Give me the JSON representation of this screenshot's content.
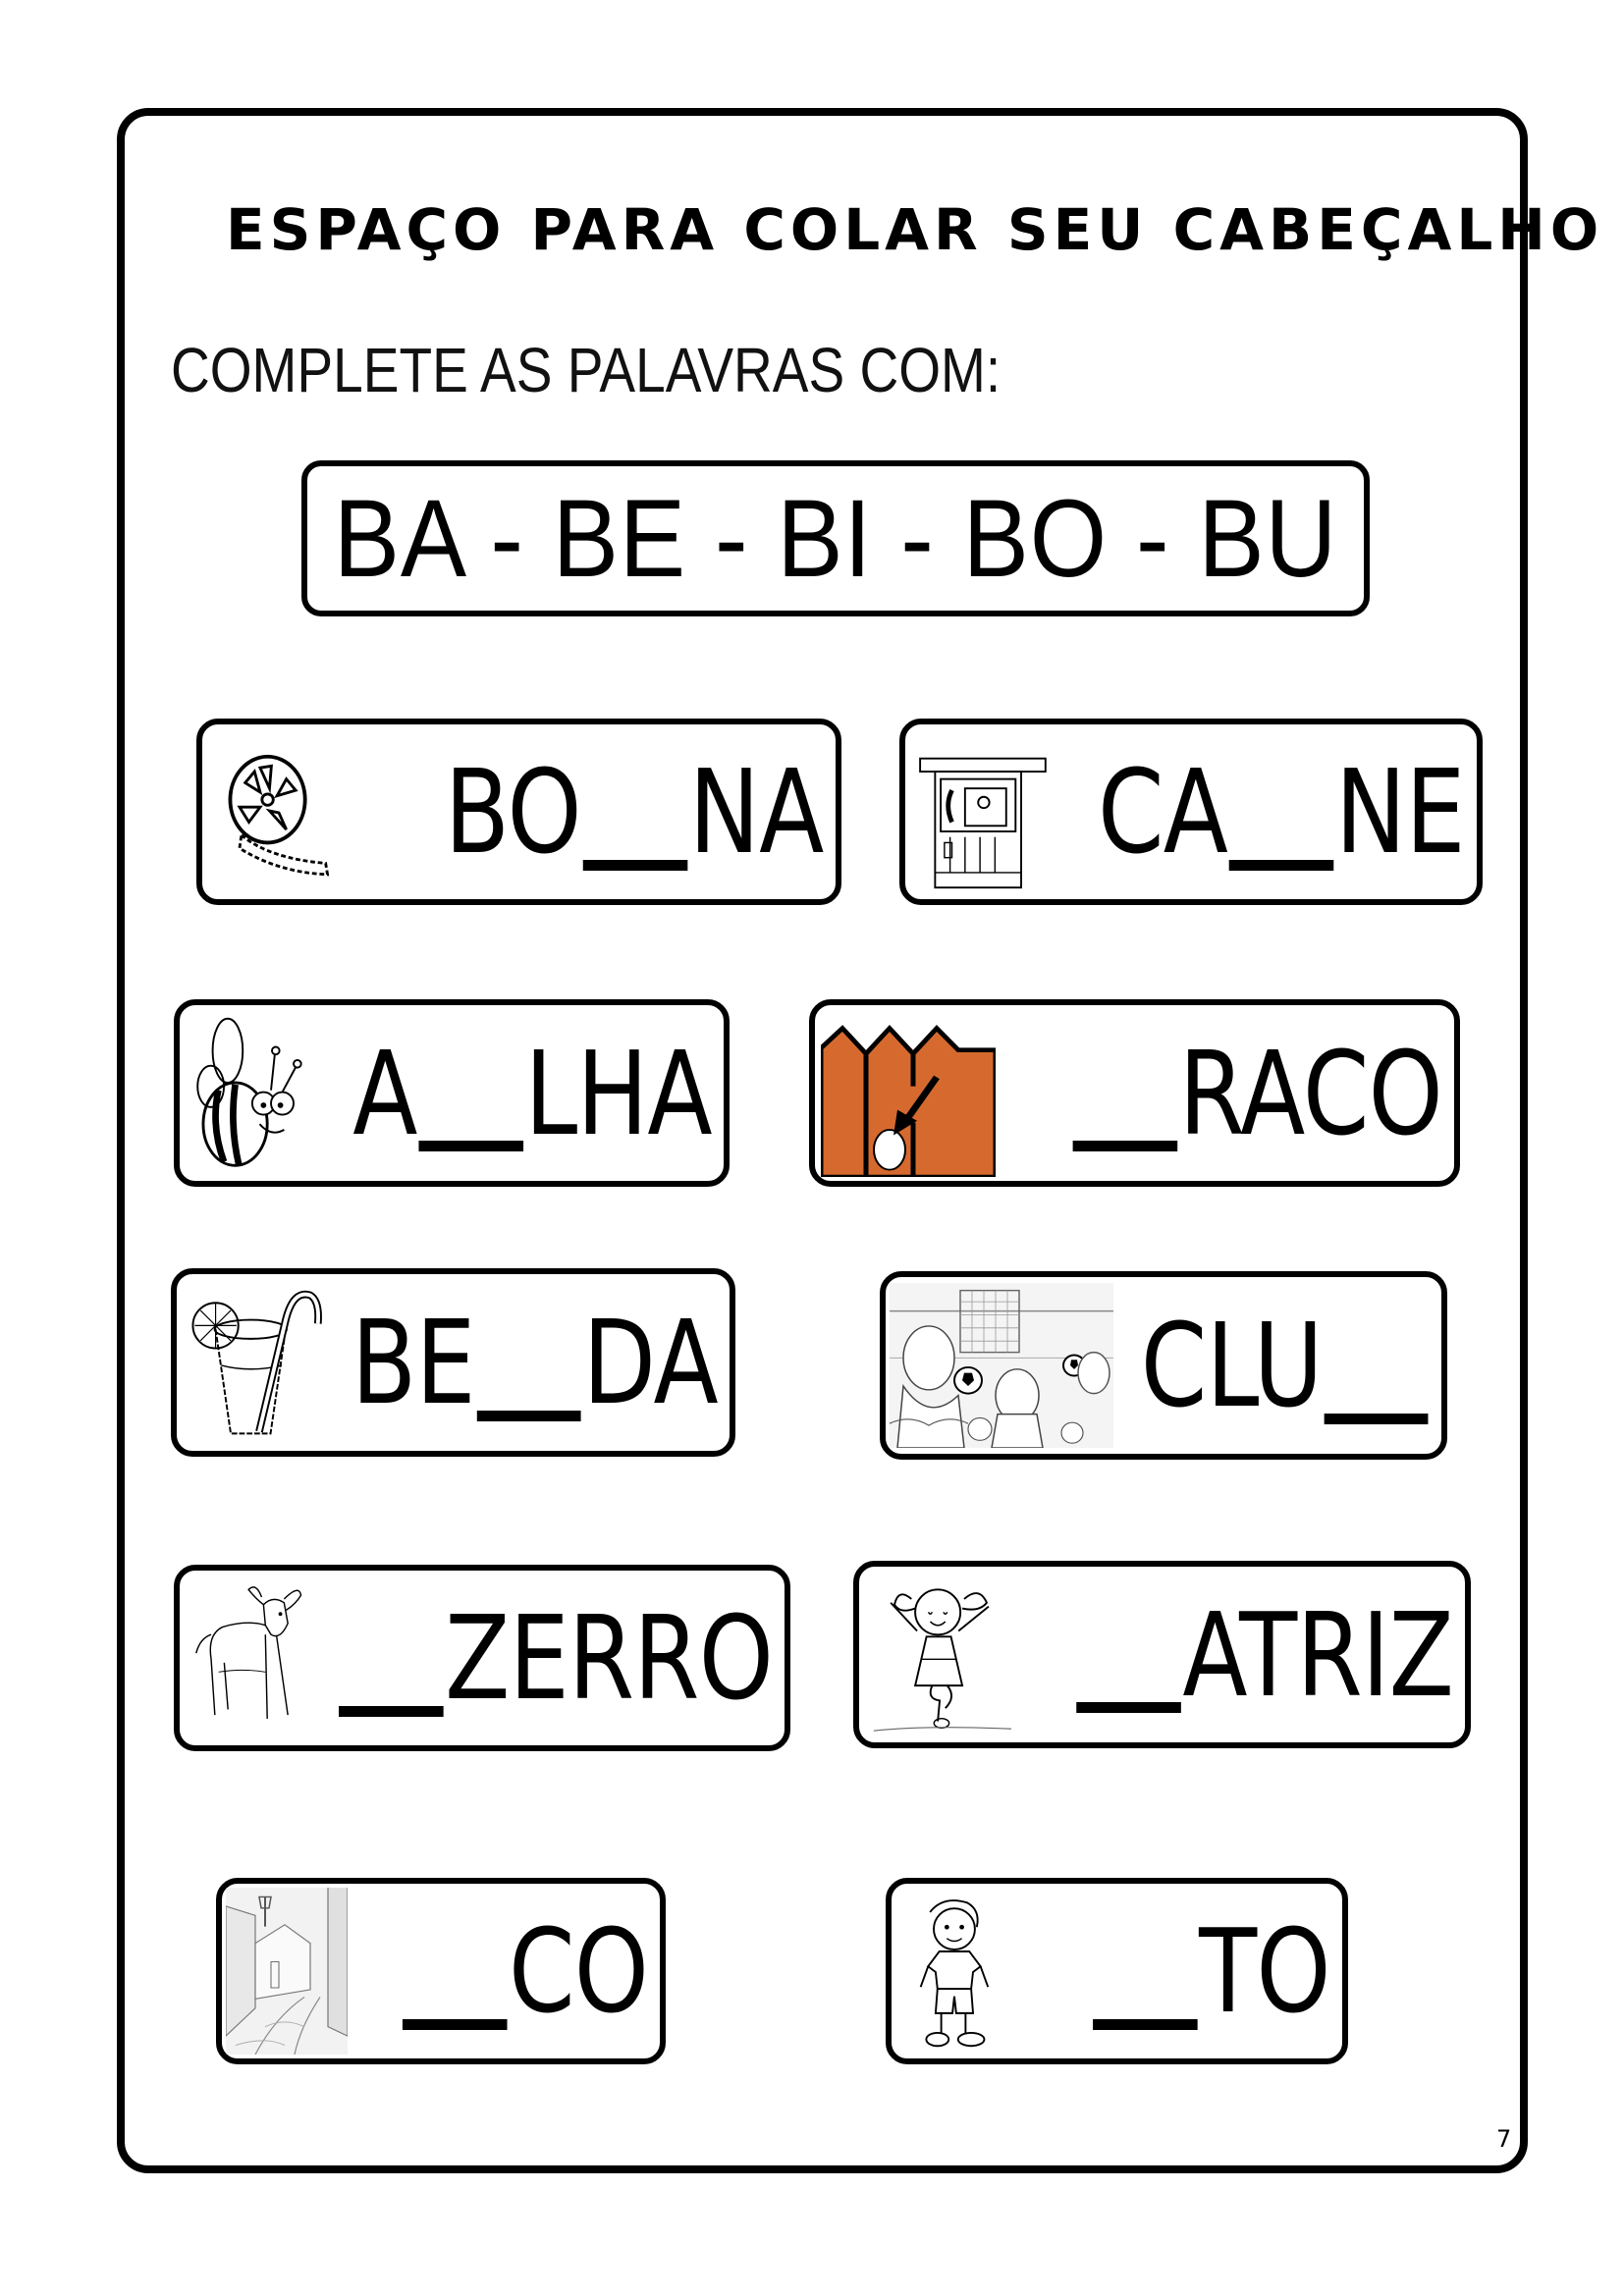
{
  "header": {
    "title": "ESPAÇO PARA COLAR SEU CABEÇALHO"
  },
  "instruction": "COMPLETE AS PALAVRAS COM:",
  "syllable_box": "BA - BE - BI - BO - BU",
  "colors": {
    "fence_orange": "#D66A2E",
    "ink": "#000000",
    "paper": "#FFFFFF"
  },
  "exercises": [
    {
      "picture": "film-reel-icon",
      "before": "BO",
      "after": "NA"
    },
    {
      "picture": "phone-booth-icon",
      "before": "CA",
      "after": "NE"
    },
    {
      "picture": "bee-icon",
      "before": "A",
      "after": "LHA"
    },
    {
      "picture": "fence-hole-icon",
      "before": "",
      "after": "RACO"
    },
    {
      "picture": "juice-glass-icon",
      "before": "BE",
      "after": "DA"
    },
    {
      "picture": "soccer-club-scene-icon",
      "before": "CLU",
      "after": ""
    },
    {
      "picture": "calf-icon",
      "before": "",
      "after": "ZERRO"
    },
    {
      "picture": "dancing-girl-icon",
      "before": "",
      "after": "ATRIZ"
    },
    {
      "picture": "alley-street-icon",
      "before": "",
      "after": "CO"
    },
    {
      "picture": "boy-icon",
      "before": "",
      "after": "TO"
    }
  ],
  "page_number": "7"
}
